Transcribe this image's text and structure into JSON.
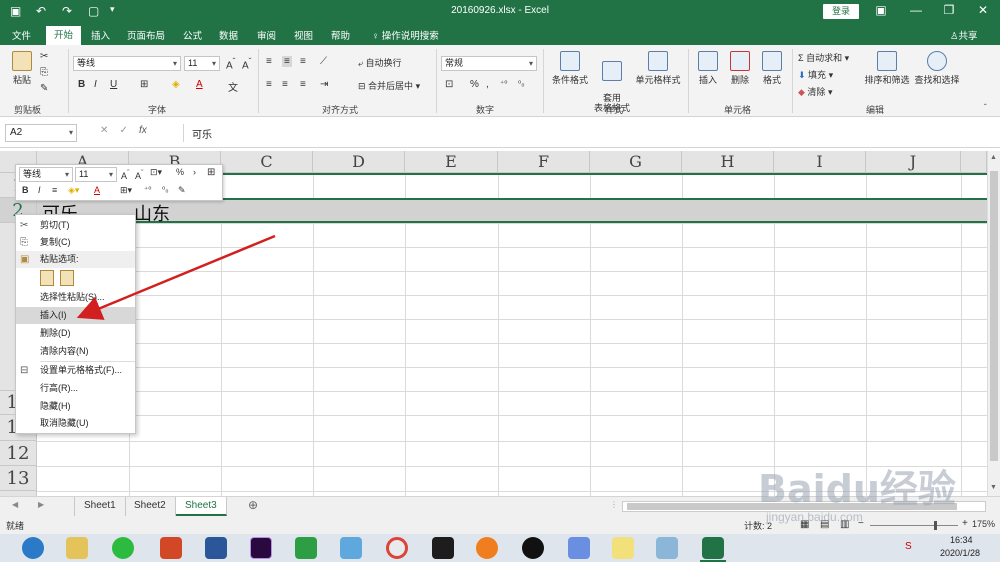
{
  "app": {
    "title": "20160926.xlsx  -  Excel",
    "login": "登录",
    "accent": "#217346"
  },
  "tabs": [
    "文件",
    "开始",
    "插入",
    "页面布局",
    "公式",
    "数据",
    "审阅",
    "视图",
    "帮助"
  ],
  "tell_me": "操作说明搜索",
  "share": "共享",
  "ribbon": {
    "clipboard": {
      "paste": "粘贴",
      "label": "剪贴板"
    },
    "font": {
      "name": "等线",
      "size": "11",
      "label": "字体"
    },
    "alignment": {
      "wrap": "自动换行",
      "merge": "合并后居中",
      "label": "对齐方式"
    },
    "number": {
      "format": "常规",
      "label": "数字"
    },
    "styles": {
      "conditional": "条件格式",
      "table": "套用\n表格格式",
      "cell": "单元格样式",
      "label": "样式"
    },
    "cells": {
      "insert": "插入",
      "delete": "删除",
      "format": "格式",
      "label": "单元格"
    },
    "editing": {
      "autosum": "自动求和",
      "fill": "填充",
      "clear": "清除",
      "sort": "排序和筛选",
      "find": "查找和选择",
      "label": "编辑"
    }
  },
  "formula_bar": {
    "name_box": "A2",
    "content": "可乐"
  },
  "grid": {
    "columns": [
      "A",
      "B",
      "C",
      "D",
      "E",
      "F",
      "G",
      "H",
      "I",
      "J"
    ],
    "rows": [
      "1",
      "2",
      "10",
      "11",
      "12",
      "13"
    ],
    "cells": {
      "A2": "可乐",
      "B2": "山东"
    }
  },
  "mini_toolbar": {
    "font": "等线",
    "size": "11"
  },
  "context_menu": {
    "items": [
      "剪切(T)",
      "复制(C)",
      "粘贴选项:",
      "选择性粘贴(S)...",
      "插入(I)",
      "删除(D)",
      "清除内容(N)",
      "设置单元格格式(F)...",
      "行高(R)...",
      "隐藏(H)",
      "取消隐藏(U)"
    ],
    "highlighted": "插入(I)"
  },
  "sheets": [
    "Sheet1",
    "Sheet2",
    "Sheet3"
  ],
  "active_sheet": "Sheet3",
  "status": {
    "ready": "就绪",
    "count": "计数: 2",
    "zoom": "175%"
  },
  "taskbar": {
    "time": "16:34",
    "date": "2020/1/28"
  },
  "watermark": "Baidu经验 jingyan.baidu.com"
}
